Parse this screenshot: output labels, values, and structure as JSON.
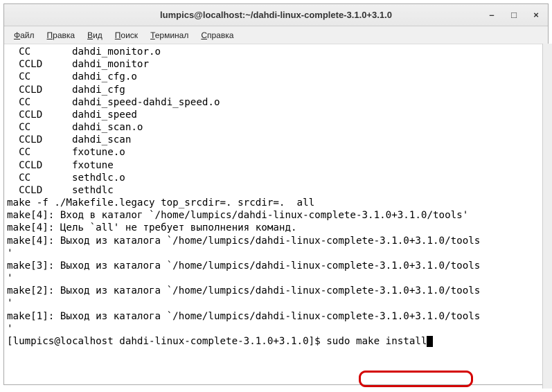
{
  "window": {
    "title": "lumpics@localhost:~/dahdi-linux-complete-3.1.0+3.1.0"
  },
  "controls": {
    "minimize": "–",
    "maximize": "□",
    "close": "×"
  },
  "menu": {
    "file": "Файл",
    "edit": "Правка",
    "view": "Вид",
    "search": "Поиск",
    "terminal": "Терминал",
    "help": "Справка"
  },
  "terminal_output": {
    "lines": [
      "  CC       dahdi_monitor.o",
      "  CCLD     dahdi_monitor",
      "  CC       dahdi_cfg.o",
      "  CCLD     dahdi_cfg",
      "  CC       dahdi_speed-dahdi_speed.o",
      "  CCLD     dahdi_speed",
      "  CC       dahdi_scan.o",
      "  CCLD     dahdi_scan",
      "  CC       fxotune.o",
      "  CCLD     fxotune",
      "  CC       sethdlc.o",
      "  CCLD     sethdlc",
      "make -f ./Makefile.legacy top_srcdir=. srcdir=.  all",
      "make[4]: Вход в каталог `/home/lumpics/dahdi-linux-complete-3.1.0+3.1.0/tools'",
      "make[4]: Цель `all' не требует выполнения команд.",
      "make[4]: Выход из каталога `/home/lumpics/dahdi-linux-complete-3.1.0+3.1.0/tools",
      "'",
      "make[3]: Выход из каталога `/home/lumpics/dahdi-linux-complete-3.1.0+3.1.0/tools",
      "'",
      "make[2]: Выход из каталога `/home/lumpics/dahdi-linux-complete-3.1.0+3.1.0/tools",
      "'",
      "make[1]: Выход из каталога `/home/lumpics/dahdi-linux-complete-3.1.0+3.1.0/tools",
      "'"
    ],
    "prompt": "[lumpics@localhost dahdi-linux-complete-3.1.0+3.1.0]$ ",
    "command": "sudo make install"
  }
}
